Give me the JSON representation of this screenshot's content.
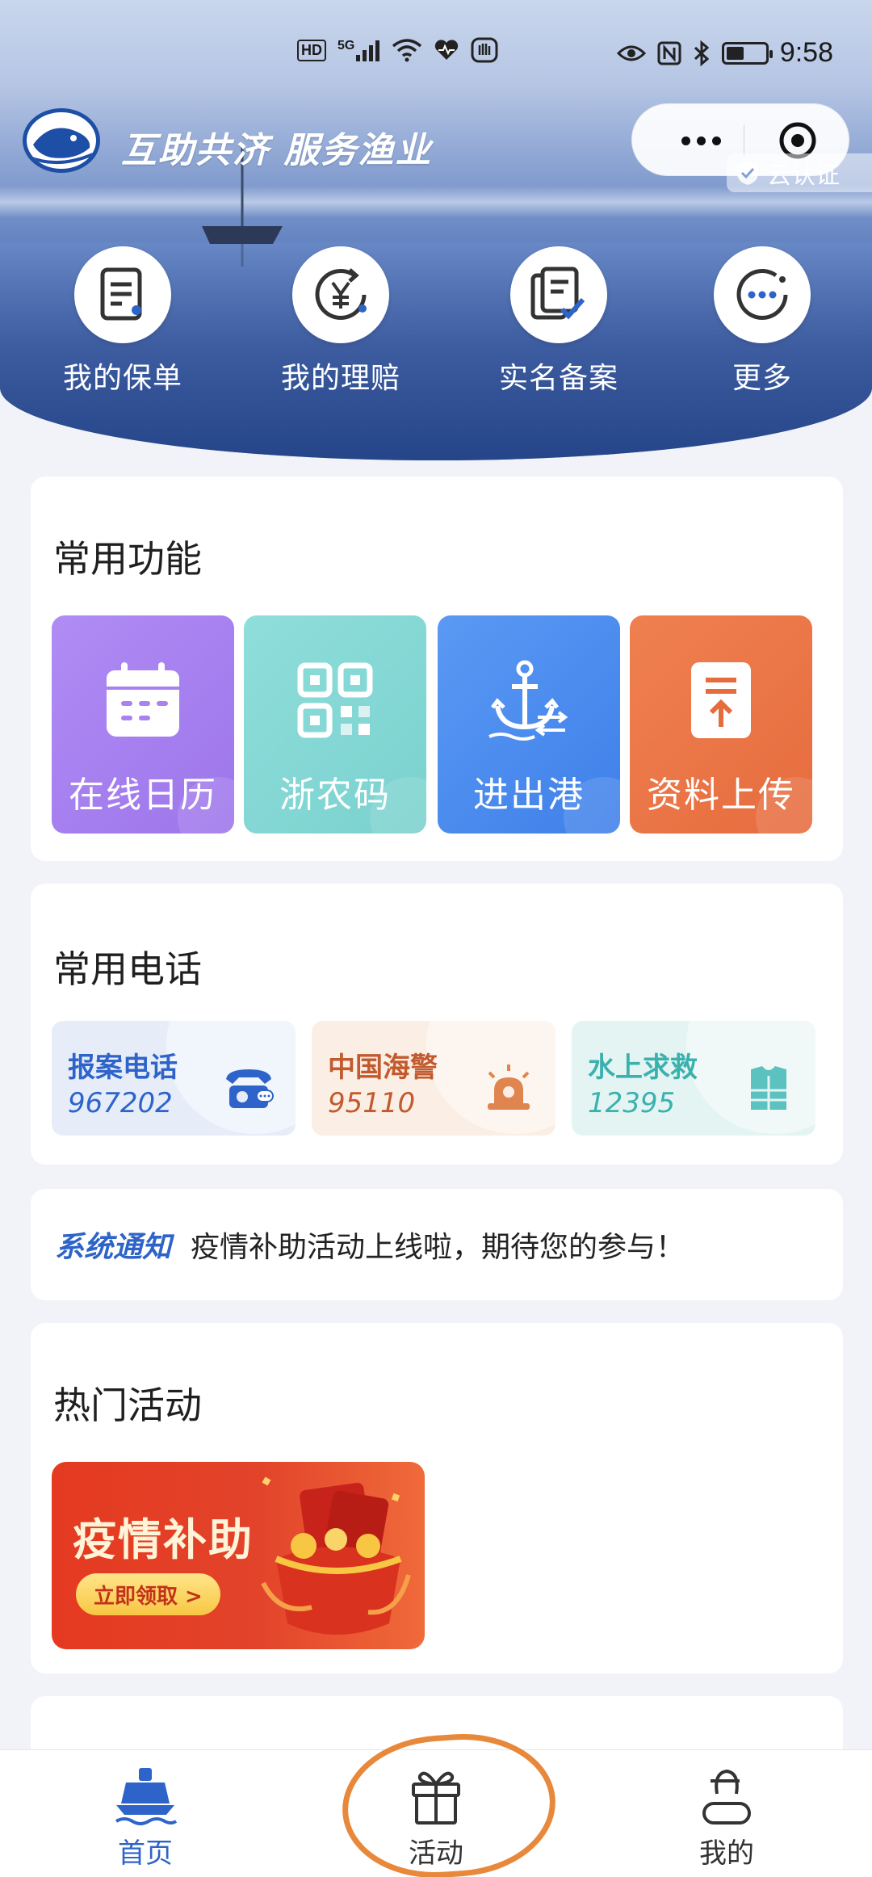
{
  "status_bar": {
    "left_icons": [
      "hd-icon",
      "signal-5g-icon",
      "wifi-icon",
      "heart-icon",
      "hand-icon"
    ],
    "hd_label": "HD",
    "network_label": "5G",
    "right_icons": [
      "eye-icon",
      "nfc-icon",
      "bluetooth-icon",
      "battery-icon"
    ],
    "time": "9:58"
  },
  "header": {
    "title": "互助共济 服务渔业",
    "cert_label": "云认证"
  },
  "quick_actions": [
    {
      "label": "我的保单",
      "icon": "policy-icon"
    },
    {
      "label": "我的理赔",
      "icon": "claim-yuan-icon"
    },
    {
      "label": "实名备案",
      "icon": "registration-icon"
    },
    {
      "label": "更多",
      "icon": "more-icon"
    }
  ],
  "common_functions": {
    "title": "常用功能",
    "items": [
      {
        "label": "在线日历",
        "icon": "calendar-icon",
        "color": "#a883ef"
      },
      {
        "label": "浙农码",
        "icon": "qr-code-icon",
        "color": "#82d8d5"
      },
      {
        "label": "进出港",
        "icon": "anchor-icon",
        "color": "#4c8def"
      },
      {
        "label": "资料上传",
        "icon": "upload-icon",
        "color": "#ea7646"
      }
    ]
  },
  "common_phones": {
    "title": "常用电话",
    "items": [
      {
        "name": "报案电话",
        "number": "967202",
        "icon": "telephone-icon",
        "color": "#2e64c9",
        "bg": "#e6edf9"
      },
      {
        "name": "中国海警",
        "number": "95110",
        "icon": "alarm-light-icon",
        "color": "#c25a2e",
        "bg": "#fbeee4"
      },
      {
        "name": "水上求救",
        "number": "12395",
        "icon": "life-jacket-icon",
        "color": "#3bb1ae",
        "bg": "#e4f4f3"
      }
    ]
  },
  "notice": {
    "tag": "系统通知",
    "text": "疫情补助活动上线啦，期待您的参与！"
  },
  "hot_activities": {
    "title": "热门活动",
    "banner": {
      "title": "疫情补助",
      "button": "立即领取 >"
    }
  },
  "tab_bar": {
    "items": [
      {
        "label": "首页",
        "icon": "ship-icon",
        "active": true
      },
      {
        "label": "活动",
        "icon": "gift-icon",
        "active": false
      },
      {
        "label": "我的",
        "icon": "profile-icon",
        "active": false
      }
    ]
  }
}
